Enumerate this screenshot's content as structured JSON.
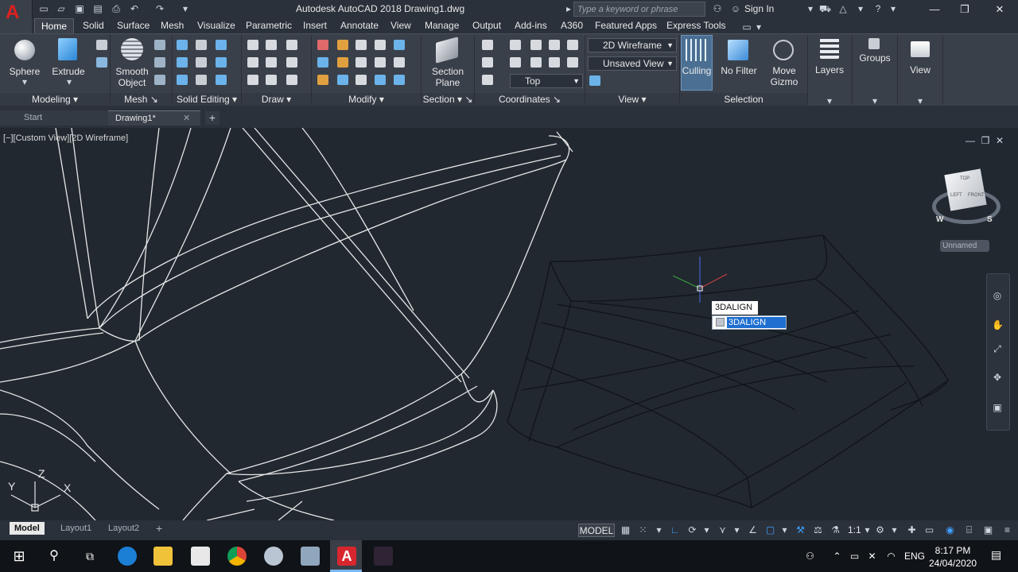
{
  "app": {
    "title": "Autodesk AutoCAD 2018    Drawing1.dwg",
    "logo_letter": "A",
    "search_placeholder": "Type a keyword or phrase",
    "sign_in": "Sign In"
  },
  "ribbon_tabs": [
    "Home",
    "Solid",
    "Surface",
    "Mesh",
    "Visualize",
    "Parametric",
    "Insert",
    "Annotate",
    "View",
    "Manage",
    "Output",
    "Add-ins",
    "A360",
    "Featured Apps",
    "Express Tools"
  ],
  "ribbon": {
    "big_buttons": {
      "sphere": "Sphere",
      "extrude": "Extrude",
      "smooth_object": "Smooth Object",
      "section_plane": "Section Plane",
      "culling": "Culling",
      "no_filter": "No Filter",
      "move_gizmo": "Move Gizmo",
      "layers": "Layers",
      "groups": "Groups",
      "view": "View"
    },
    "panels": [
      "Modeling",
      "Mesh",
      "Solid Editing",
      "Draw",
      "Modify",
      "Section",
      "Coordinates",
      "View",
      "Selection"
    ],
    "dropdowns": {
      "visual_style": "2D Wireframe",
      "named_view": "Unsaved View",
      "ucs_view": "Top"
    }
  },
  "file_tabs": {
    "start": "Start",
    "drawing": "Drawing1*",
    "new_tab": "+"
  },
  "viewport": {
    "label": "[−][Custom View][2D Wireframe]",
    "viewcube_label": "Unnamed",
    "viewcube_faces": [
      "TOP",
      "LEFT",
      "FRONT"
    ],
    "compass": [
      "W",
      "S"
    ],
    "ucs_axes": [
      "Z",
      "Y",
      "X"
    ]
  },
  "command": {
    "typed": "3DALIGN",
    "suggestion": "3DALIGN"
  },
  "layout_tabs": [
    "Model",
    "Layout1",
    "Layout2",
    "+"
  ],
  "status": {
    "space": "MODEL",
    "scale": "1:1"
  },
  "taskbar": {
    "time": "8:17 PM",
    "date": "24/04/2020",
    "language": "ENG",
    "apps": [
      "start-icon",
      "search-icon",
      "task-view-icon",
      "edge-icon",
      "file-explorer-icon",
      "calculator-icon",
      "chrome-icon",
      "paint-icon",
      "network-app-icon",
      "autocad-icon",
      "media-app-icon"
    ]
  },
  "colors": {
    "background": "#212830",
    "ribbon": "#3a404a",
    "accent_red": "#e02020",
    "highlight_blue": "#1e6fd0"
  }
}
